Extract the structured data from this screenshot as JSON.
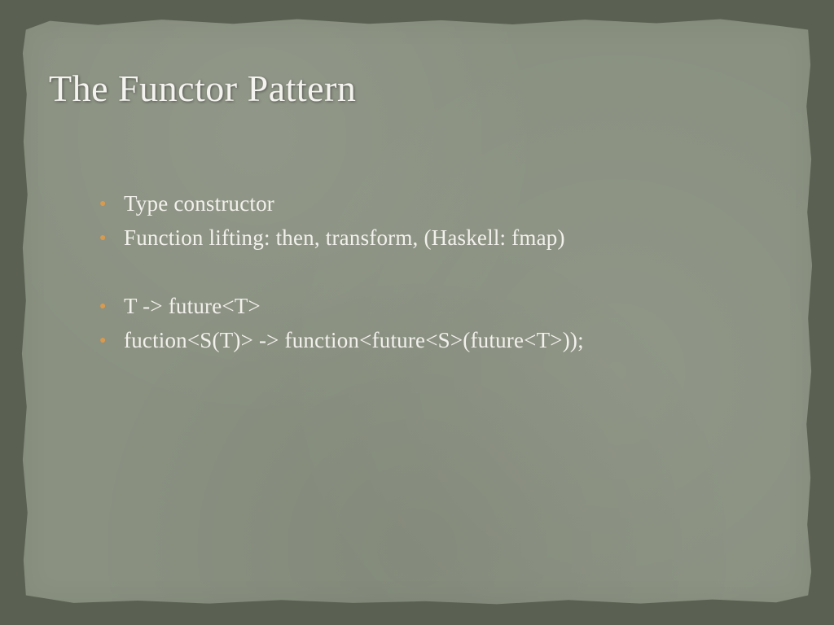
{
  "slide": {
    "title": "The Functor Pattern",
    "bullets": [
      "Type constructor",
      "Function lifting: then, transform, (Haskell: fmap)",
      "T -> future<T>",
      "fuction<S(T)> -> function<future<S>(future<T>));"
    ]
  }
}
